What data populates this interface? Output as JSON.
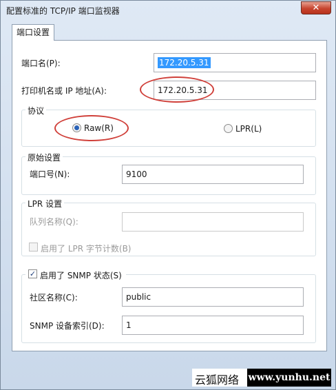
{
  "window": {
    "title": "配置标准的 TCP/IP 端口监视器",
    "close_glyph": "✕"
  },
  "tab": {
    "label": "端口设置"
  },
  "port_name": {
    "label": "端口名(P):",
    "value": "172.20.5.31"
  },
  "printer_address": {
    "label": "打印机名或 IP 地址(A):",
    "value": "172.20.5.31"
  },
  "protocol": {
    "legend": "协议",
    "raw_label": "Raw(R)",
    "lpr_label": "LPR(L)",
    "selected": "Raw"
  },
  "raw_settings": {
    "legend": "原始设置",
    "port_label": "端口号(N):",
    "port_value": "9100"
  },
  "lpr_settings": {
    "legend": "LPR 设置",
    "queue_label": "队列名称(Q):",
    "queue_value": "",
    "byte_count_label": "启用了 LPR 字节计数(B)"
  },
  "snmp": {
    "enabled_label": "启用了 SNMP 状态(S)",
    "enabled_check": "✓",
    "community_label": "社区名称(C):",
    "community_value": "public",
    "index_label": "SNMP 设备索引(D):",
    "index_value": "1"
  },
  "watermark": {
    "cn": "云狐网络",
    "url": "www.yunhu.net"
  },
  "colors": {
    "annotation": "#d0403a",
    "selection": "#3399ff",
    "close": "#c7452f"
  }
}
